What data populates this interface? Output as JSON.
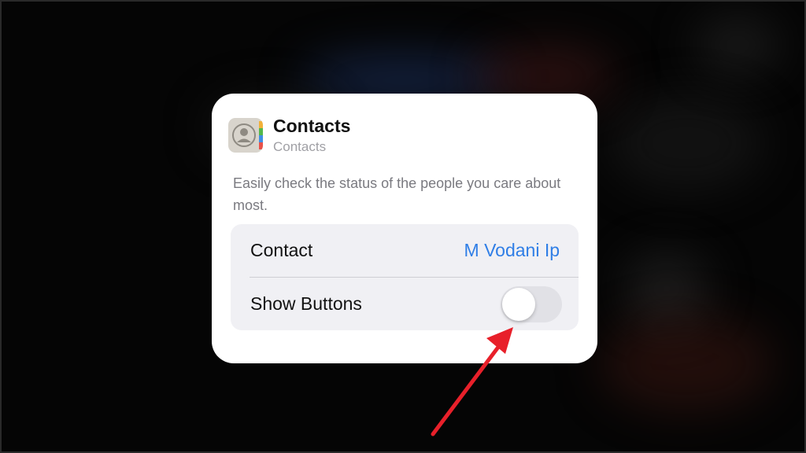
{
  "widget": {
    "app_icon": "contacts-app-icon",
    "title": "Contacts",
    "subtitle": "Contacts",
    "description": "Easily check the status of the people you care about most.",
    "settings": [
      {
        "label": "Contact",
        "value": "M Vodani Ip"
      },
      {
        "label": "Show Buttons",
        "toggle_on": false
      }
    ]
  },
  "annotation": {
    "icon": "red-arrow-icon",
    "color": "#e8202a"
  },
  "colors": {
    "accent_blue": "#2f7ee6",
    "card_background": "#ffffff",
    "settings_background": "#f0f0f4",
    "icon_tabs": [
      "#f2b13a",
      "#54b84c",
      "#3f8fe6",
      "#e8524a"
    ]
  }
}
